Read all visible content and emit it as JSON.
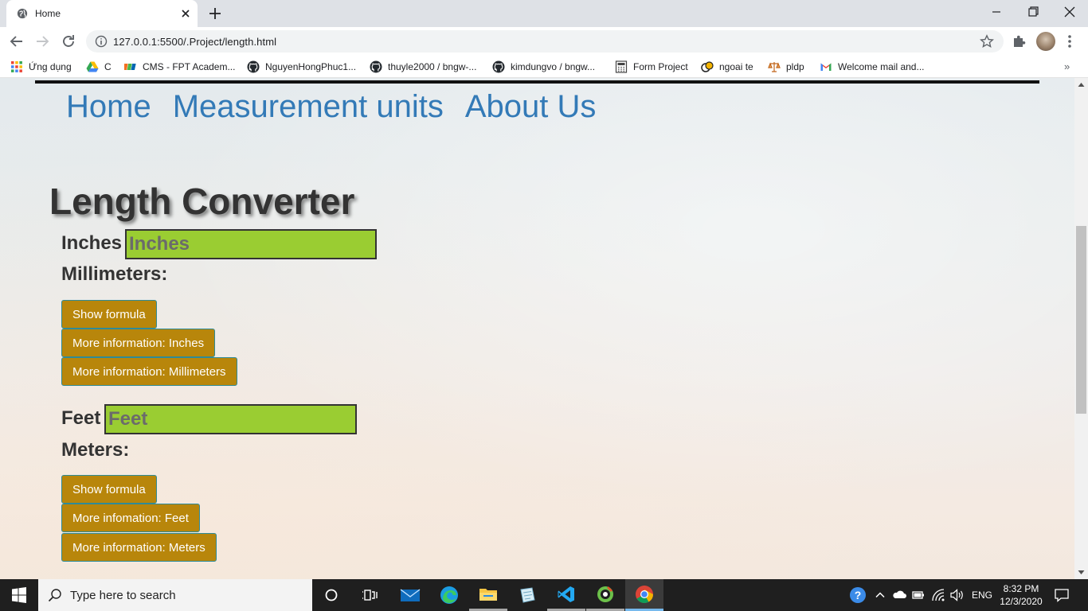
{
  "browser": {
    "tab": {
      "title": "Home"
    },
    "address_bar": {
      "url": "127.0.0.1:5500/.Project/length.html"
    },
    "bookmarks": [
      {
        "label": "Ứng dụng",
        "icon": "apps-grid-icon"
      },
      {
        "label": "C",
        "icon": "google-drive-icon"
      },
      {
        "label": "CMS - FPT Academ...",
        "icon": "fpt-icon"
      },
      {
        "label": "NguyenHongPhuc1...",
        "icon": "github-icon"
      },
      {
        "label": "thuyle2000 / bngw-...",
        "icon": "github-icon"
      },
      {
        "label": "kimdungvo / bngw...",
        "icon": "github-icon"
      },
      {
        "label": "Form Project",
        "icon": "calculator-icon"
      },
      {
        "label": "ngoai te",
        "icon": "currency-icon"
      },
      {
        "label": "pldp",
        "icon": "scale-icon"
      },
      {
        "label": "Welcome mail and...",
        "icon": "gmail-icon"
      }
    ],
    "bookmarks_overflow": "»"
  },
  "page": {
    "nav": [
      {
        "label": "Home"
      },
      {
        "label": "Measurement units"
      },
      {
        "label": "About Us"
      }
    ],
    "heading": "Length Converter",
    "converters": [
      {
        "input_label": "Inches",
        "input_placeholder": "Inches",
        "input_value": "",
        "result_label": "Millimeters:",
        "buttons": [
          "Show formula",
          "More information: Inches",
          "More information: Millimeters"
        ]
      },
      {
        "input_label": "Feet",
        "input_placeholder": "Feet",
        "input_value": "",
        "result_label": "Meters:",
        "buttons": [
          "Show formula",
          "More infomation: Feet",
          "More information: Meters"
        ]
      }
    ],
    "colors": {
      "nav_link": "#337ab7",
      "input_bg": "#9acd32",
      "button_bg": "#b8860b",
      "text": "#333333"
    }
  },
  "taskbar": {
    "search_placeholder": "Type here to search",
    "apps": [
      "cortana-icon",
      "task-view-icon",
      "mail-icon",
      "edge-icon",
      "file-explorer-icon",
      "notes-icon",
      "vscode-icon",
      "app-icon",
      "chrome-icon"
    ],
    "tray": {
      "language": "ENG"
    },
    "clock": {
      "time": "8:32 PM",
      "date": "12/3/2020"
    }
  }
}
